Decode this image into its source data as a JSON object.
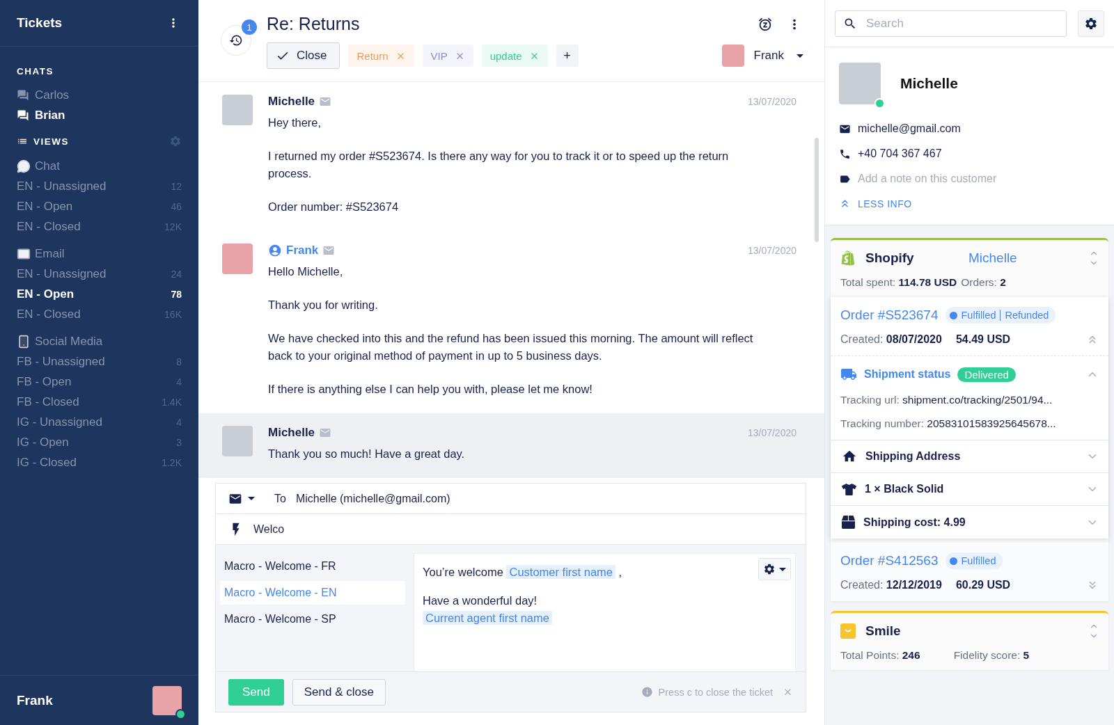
{
  "sidebar": {
    "title": "Tickets",
    "chats_heading": "CHATS",
    "chats": [
      {
        "name": "Carlos",
        "selected": false
      },
      {
        "name": "Brian",
        "selected": true
      }
    ],
    "views_heading": "VIEWS",
    "view_groups": [
      {
        "label": "Chat",
        "views": [
          {
            "label": "EN - Unassigned",
            "count": "12",
            "selected": false
          },
          {
            "label": "EN - Open",
            "count": "46",
            "selected": false
          },
          {
            "label": "EN - Closed",
            "count": "12K",
            "selected": false
          }
        ]
      },
      {
        "label": "Email",
        "views": [
          {
            "label": "EN - Unassigned",
            "count": "24",
            "selected": false
          },
          {
            "label": "EN - Open",
            "count": "78",
            "selected": true
          },
          {
            "label": "EN - Closed",
            "count": "16K",
            "selected": false
          }
        ]
      },
      {
        "label": "Social Media",
        "views": [
          {
            "label": "FB - Unassigned",
            "count": "8",
            "selected": false
          },
          {
            "label": "FB - Open",
            "count": "4",
            "selected": false
          },
          {
            "label": "FB - Closed",
            "count": "1.4K",
            "selected": false
          },
          {
            "label": "IG - Unassigned",
            "count": "4",
            "selected": false
          },
          {
            "label": "IG - Open",
            "count": "3",
            "selected": false
          },
          {
            "label": "IG - Closed",
            "count": "1.2K",
            "selected": false
          }
        ]
      }
    ],
    "user": {
      "name": "Frank",
      "online": true
    }
  },
  "ticket": {
    "unread_count": "1",
    "title": "Re: Returns",
    "close_label": "Close",
    "tags": [
      {
        "label": "Return",
        "color": "#f09a52"
      },
      {
        "label": "VIP",
        "color": "#8a8ed8"
      },
      {
        "label": "update",
        "color": "#2ecf94"
      }
    ],
    "add_tag": "+",
    "assignee": "Frank"
  },
  "messages": [
    {
      "author": "Michelle",
      "kind": "customer",
      "date": "13/07/2020",
      "highlighted": false,
      "paragraphs": [
        "Hey there,",
        "I returned my order #S523674. Is there any way for you to track it or to speed up the return process.",
        "Order number: #S523674"
      ]
    },
    {
      "author": "Frank",
      "kind": "agent",
      "date": "13/07/2020",
      "highlighted": false,
      "paragraphs": [
        "Hello Michelle,",
        "Thank you for writing.",
        "We have checked into this and the refund has been issued this morning. The amount will reflect back to your original method of payment in up to 5 business days.",
        "If there is anything else I can help you with, please let me know!"
      ]
    },
    {
      "author": "Michelle",
      "kind": "customer",
      "date": "13/07/2020",
      "highlighted": true,
      "paragraphs": [
        "Thank you so much! Have a great day."
      ]
    }
  ],
  "composer": {
    "to_label": "To",
    "recipient": "Michelle (michelle@gmail.com)",
    "macro_query": "Welco",
    "macros": [
      {
        "label": "Macro - Welcome - FR",
        "selected": false
      },
      {
        "label": "Macro - Welcome - EN",
        "selected": true
      },
      {
        "label": "Macro - Welcome - SP",
        "selected": false
      }
    ],
    "preview": [
      {
        "lines": [
          [
            {
              "kind": "text",
              "text": "You’re welcome "
            },
            {
              "kind": "variable",
              "text": "Customer first name"
            },
            {
              "kind": "text",
              "text": " ,"
            }
          ]
        ]
      },
      {
        "lines": [
          [
            {
              "kind": "text",
              "text": "Have a wonderful day!"
            }
          ],
          [
            {
              "kind": "variable",
              "text": "Current agent first name"
            }
          ]
        ]
      }
    ],
    "send": "Send",
    "send_close": "Send & close",
    "hint": "Press c to close the ticket"
  },
  "customer_panel": {
    "search_placeholder": "Search",
    "customer": {
      "name": "Michelle",
      "online": true,
      "email": "michelle@gmail.com",
      "phone": "+40 704 367 467",
      "note_placeholder": "Add a note on this customer",
      "less_info": "LESS INFO"
    },
    "widgets": [
      {
        "kind": "shopify",
        "color": "#95bf47",
        "title": "Shopify",
        "customer": "Michelle",
        "stats": [
          {
            "label": "Total spent:",
            "value": "114.78 USD"
          },
          {
            "label": "Orders:",
            "value": "2"
          }
        ],
        "orders": [
          {
            "number": "Order #S523674",
            "statuses": [
              "Fulfilled",
              "Refunded"
            ],
            "created_label": "Created:",
            "created": "08/07/2020",
            "amount": "54.49 USD",
            "expanded": true,
            "shipment": {
              "label": "Shipment status",
              "status": "Delivered",
              "expanded": true,
              "fields": [
                {
                  "label": "Tracking url:",
                  "value": "shipment.co/tracking/2501/94..."
                },
                {
                  "label": "Tracking number:",
                  "value": "20583101583925645678..."
                }
              ]
            },
            "details": [
              {
                "kind": "address",
                "label": "Shipping Address",
                "expanded": false
              },
              {
                "kind": "item",
                "label": "1 × Black Solid",
                "expanded": false
              },
              {
                "kind": "cost",
                "label": "Shipping cost: 4.99",
                "expanded": false
              }
            ]
          },
          {
            "number": "Order #S412563",
            "statuses": [
              "Fulfilled"
            ],
            "created_label": "Created:",
            "created": "12/12/2019",
            "amount": "60.29 USD",
            "expanded": false
          }
        ]
      },
      {
        "kind": "smile",
        "color": "#f7c331",
        "title": "Smile",
        "stats": [
          {
            "label": "Total Points:",
            "value": "246"
          },
          {
            "label": "Fidelity score:",
            "value": "5"
          }
        ]
      }
    ]
  }
}
